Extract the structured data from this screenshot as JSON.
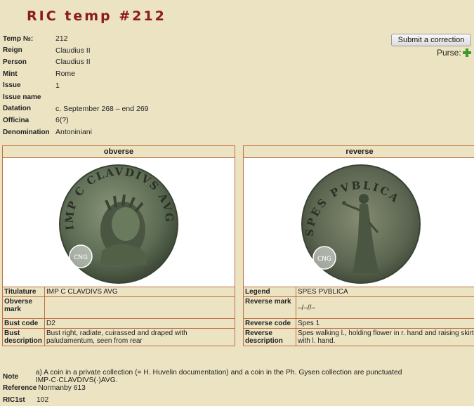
{
  "title": "RIC temp #212",
  "meta": [
    {
      "key": "Temp №:",
      "value": "212"
    },
    {
      "key": "Reign",
      "value": "Claudius II"
    },
    {
      "key": "Person",
      "value": "Claudius II"
    },
    {
      "key": "Mint",
      "value": "Rome"
    },
    {
      "key": "Issue",
      "value": "1"
    },
    {
      "key": "Issue name",
      "value": ""
    },
    {
      "key": "Datation",
      "value": "c. September 268 – end 269"
    },
    {
      "key": "Officina",
      "value": "6(?)"
    },
    {
      "key": "Denomination",
      "value": "Antoniniani"
    }
  ],
  "actions": {
    "correction": "Submit a correction",
    "purse": "Purse:"
  },
  "obverse": {
    "heading": "obverse",
    "legend_ring": "IMP C CLAVDIVS AVG",
    "rows": [
      {
        "key": "Titulature",
        "value": "IMP C CLAVDIVS AVG"
      },
      {
        "key": "Obverse mark",
        "value": ""
      },
      {
        "key": "Bust code",
        "value": "D2"
      },
      {
        "key": "Bust description",
        "value": "Bust right, radiate, cuirassed and draped with paludamentum, seen from rear"
      }
    ]
  },
  "reverse": {
    "heading": "reverse",
    "legend_ring": "SPES PVBLICA",
    "rows": [
      {
        "key": "Legend",
        "value": "SPES PVBLICA"
      },
      {
        "key": "Reverse mark",
        "value": "–/–//–"
      },
      {
        "key": "Reverse code",
        "value": "Spes 1"
      },
      {
        "key": "Reverse description",
        "value": "Spes walking l., holding flower in r. hand and raising skirt with l. hand."
      }
    ]
  },
  "note": {
    "note_key": "Note",
    "note_value": "a) A coin in a private collection (= H. Huvelin documentation) and a coin in the Ph. Gysen collection are punctuated IMP·C·CLAVDIVS(·)AVG.",
    "reference_key": "Reference",
    "reference_value": "Normanby 613",
    "ric_key": "RIC1st",
    "ric_value": "102"
  },
  "watermark": "CNG",
  "colors": {
    "title": "#8b1a1a",
    "border": "#c07040",
    "page": "#ece3c2",
    "coin": "#5b6a52"
  }
}
